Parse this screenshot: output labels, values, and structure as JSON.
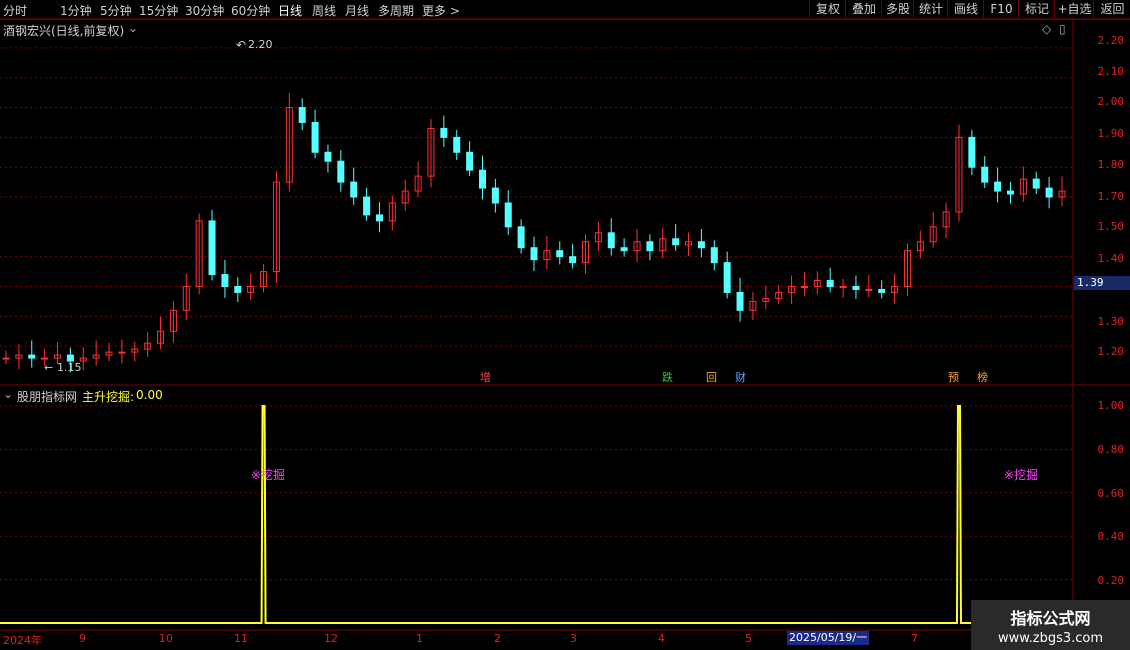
{
  "toolbar": {
    "periods": [
      "分时",
      "1分钟",
      "5分钟",
      "15分钟",
      "30分钟",
      "60分钟",
      "日线",
      "周线",
      "月线",
      "多周期",
      "更多 >"
    ],
    "active_period": "日线",
    "right_buttons": [
      "复权",
      "叠加",
      "多股",
      "统计",
      "画线",
      "F10",
      "标记",
      "+自选",
      "返回"
    ]
  },
  "main_pane": {
    "stock_title": "酒钢宏兴(日线,前复权)",
    "high_marker": "2.20",
    "low_marker": "1.15",
    "current_price": "1.39",
    "price_axis": [
      "2.20",
      "2.10",
      "2.00",
      "1.90",
      "1.80",
      "1.70",
      "1.50",
      "1.40",
      "1.30",
      "1.20"
    ],
    "events": [
      {
        "label": "增",
        "color": "#ff4040"
      },
      {
        "label": "跌",
        "color": "#20d020"
      },
      {
        "label": "回",
        "color": "#ffa020"
      },
      {
        "label": "财",
        "color": "#60a0ff"
      },
      {
        "label": "预",
        "color": "#ffa020"
      },
      {
        "label": "榜",
        "color": "#ffa020"
      }
    ]
  },
  "indicator_pane": {
    "source": "股朋指标网",
    "indicator_name": "主升挖掘:",
    "indicator_value": "0.00",
    "signal_label": "※挖掘",
    "axis": [
      "1.00",
      "0.80",
      "0.60",
      "0.40",
      "0.20"
    ]
  },
  "date_axis": [
    "2024年",
    "9",
    "10",
    "11",
    "12",
    "1",
    "2",
    "3",
    "4",
    "5",
    "2025/05/19/一",
    "7"
  ],
  "watermark": {
    "title": "指标公式网",
    "url": "www.zbgs3.com"
  },
  "colors": {
    "up": "#ff3030",
    "down": "#54ffff",
    "signal": "#ffff30",
    "signal_text": "#ff40ff",
    "grid": "#7a0000"
  },
  "chart_data": {
    "type": "candlestick",
    "title": "酒钢宏兴(日线,前复权)",
    "ylim": [
      1.12,
      2.26
    ],
    "close_series": [
      1.16,
      1.17,
      1.16,
      1.16,
      1.17,
      1.15,
      1.16,
      1.17,
      1.18,
      1.18,
      1.19,
      1.21,
      1.25,
      1.32,
      1.4,
      1.62,
      1.44,
      1.4,
      1.38,
      1.4,
      1.45,
      1.75,
      2.0,
      1.95,
      1.85,
      1.82,
      1.75,
      1.7,
      1.64,
      1.62,
      1.68,
      1.72,
      1.77,
      1.93,
      1.9,
      1.85,
      1.79,
      1.73,
      1.68,
      1.6,
      1.53,
      1.49,
      1.52,
      1.5,
      1.48,
      1.55,
      1.58,
      1.53,
      1.52,
      1.55,
      1.52,
      1.56,
      1.54,
      1.55,
      1.53,
      1.48,
      1.38,
      1.32,
      1.35,
      1.36,
      1.38,
      1.4,
      1.4,
      1.42,
      1.4,
      1.4,
      1.39,
      1.39,
      1.38,
      1.4,
      1.52,
      1.55,
      1.6,
      1.65,
      1.9,
      1.8,
      1.75,
      1.72,
      1.71,
      1.76,
      1.73,
      1.7,
      1.72
    ],
    "indicator": {
      "name": "主升挖掘",
      "spikes": [
        {
          "date_index": 20,
          "value": 1.0
        },
        {
          "date_index": 74,
          "value": 1.0
        }
      ],
      "baseline": 0.0
    }
  }
}
